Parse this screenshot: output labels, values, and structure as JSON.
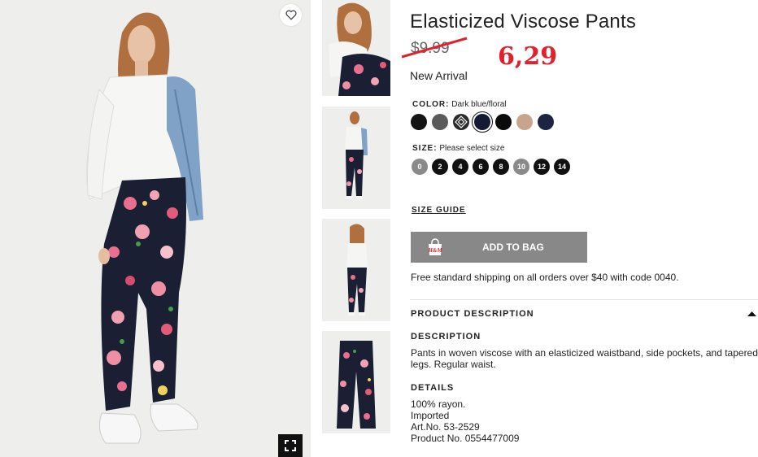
{
  "product": {
    "title": "Elasticized Viscose Pants",
    "old_price": "$9.99",
    "new_price": "6,29",
    "badge": "New Arrival"
  },
  "color": {
    "label": "COLOR:",
    "value": "Dark blue/floral",
    "swatches": [
      {
        "name": "black",
        "hex": "#141414"
      },
      {
        "name": "dark-gray",
        "hex": "#5a5a5a"
      },
      {
        "name": "patterned",
        "hex": "#2b2b2b"
      },
      {
        "name": "dark-blue-floral",
        "hex": "#141a33",
        "selected": true
      },
      {
        "name": "black-2",
        "hex": "#0b0b0b"
      },
      {
        "name": "beige",
        "hex": "#c9a48c"
      },
      {
        "name": "navy",
        "hex": "#1d2342"
      }
    ]
  },
  "size": {
    "label": "SIZE:",
    "prompt": "Please select size",
    "options": [
      {
        "label": "0",
        "available": false
      },
      {
        "label": "2",
        "available": true
      },
      {
        "label": "4",
        "available": true
      },
      {
        "label": "6",
        "available": true
      },
      {
        "label": "8",
        "available": true
      },
      {
        "label": "10",
        "available": false
      },
      {
        "label": "12",
        "available": true
      },
      {
        "label": "14",
        "available": true
      }
    ]
  },
  "size_guide": "SIZE GUIDE",
  "add_to_bag": "ADD TO BAG",
  "bag_logo": "H&M",
  "shipping": "Free standard shipping on all orders over $40 with code 0040.",
  "product_description": {
    "heading": "PRODUCT DESCRIPTION",
    "description_heading": "DESCRIPTION",
    "description": "Pants in woven viscose with an elasticized waistband, side pockets, and tapered legs. Regular waist.",
    "details_heading": "DETAILS",
    "details": [
      "100% rayon.",
      "Imported",
      "Art.No. 53-2529",
      "Product No. 0554477009"
    ]
  },
  "icons": {
    "favorite": "heart-icon",
    "expand": "fullscreen-icon",
    "bag": "shopping-bag-icon",
    "collapse": "caret-up-icon"
  },
  "colors": {
    "accent_price": "#e3202b",
    "button": "#888888",
    "size_available": "#111111",
    "size_unavailable": "#8a8a8a"
  }
}
